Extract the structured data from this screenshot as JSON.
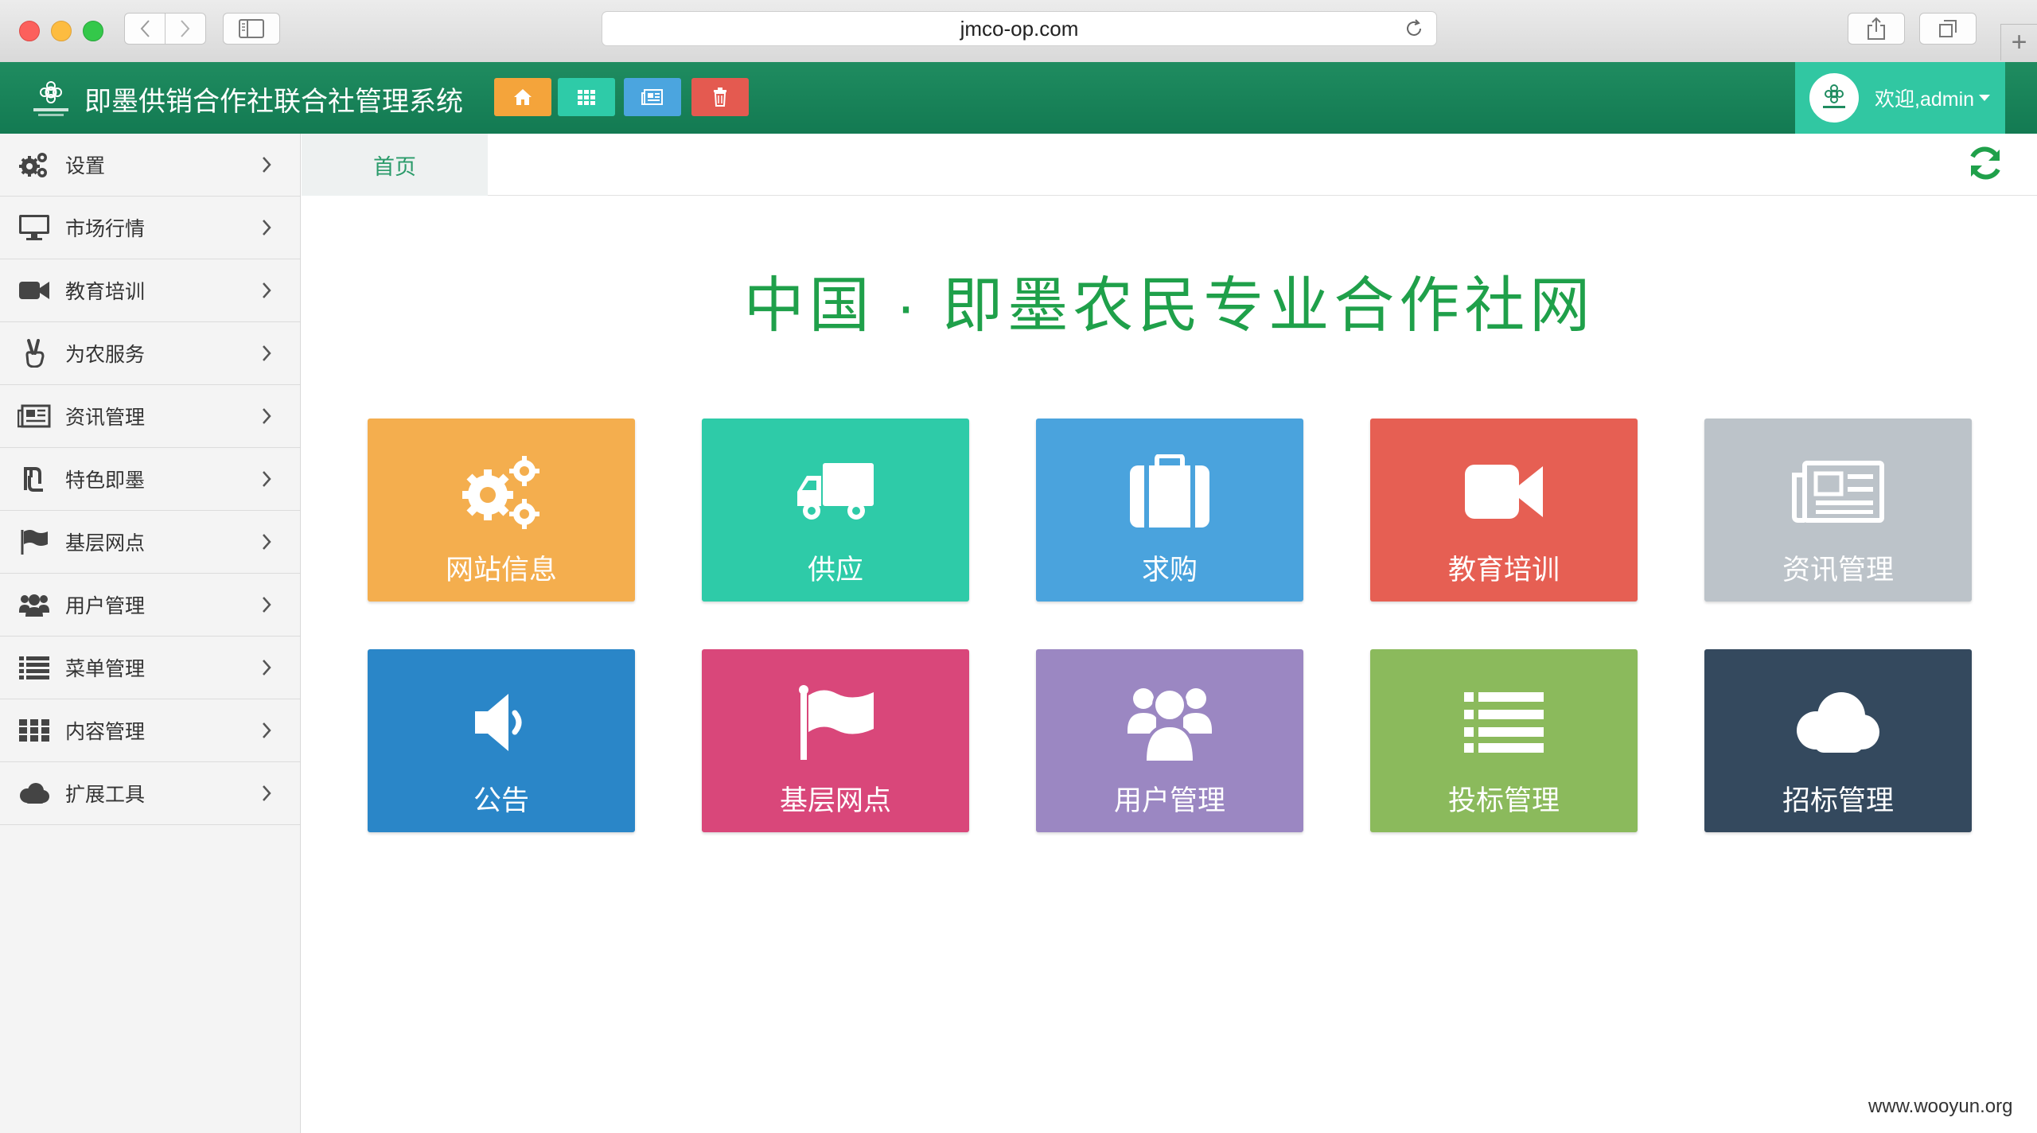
{
  "browser": {
    "url": "jmco-op.com",
    "new_tab_symbol": "+"
  },
  "header": {
    "title": "即墨供销合作社联合社管理系统",
    "user_greeting": "欢迎,admin"
  },
  "sidebar": {
    "items": [
      {
        "label": "设置",
        "icon": "gears-icon"
      },
      {
        "label": "市场行情",
        "icon": "desktop-icon"
      },
      {
        "label": "教育培训",
        "icon": "video-camera-icon"
      },
      {
        "label": "为农服务",
        "icon": "victory-hand-icon"
      },
      {
        "label": "资讯管理",
        "icon": "newspaper-icon"
      },
      {
        "label": "特色即墨",
        "icon": "shekel-icon"
      },
      {
        "label": "基层网点",
        "icon": "flag-icon"
      },
      {
        "label": "用户管理",
        "icon": "users-icon"
      },
      {
        "label": "菜单管理",
        "icon": "list-icon"
      },
      {
        "label": "内容管理",
        "icon": "grid-icon"
      },
      {
        "label": "扩展工具",
        "icon": "cloud-icon"
      }
    ]
  },
  "tabs": {
    "home": "首页"
  },
  "main": {
    "title": "中国 · 即墨农民专业合作社网",
    "tiles": [
      {
        "label": "网站信息",
        "icon": "gears-icon",
        "color": "#f4ae4e"
      },
      {
        "label": "供应",
        "icon": "truck-icon",
        "color": "#2ecba8"
      },
      {
        "label": "求购",
        "icon": "briefcase-icon",
        "color": "#4aa3dd"
      },
      {
        "label": "教育培训",
        "icon": "video-camera-icon",
        "color": "#e65f53"
      },
      {
        "label": "资讯管理",
        "icon": "newspaper-icon",
        "color": "#bcc3c9"
      },
      {
        "label": "公告",
        "icon": "volume-icon",
        "color": "#2a86c8"
      },
      {
        "label": "基层网点",
        "icon": "flag-icon",
        "color": "#d9477a"
      },
      {
        "label": "用户管理",
        "icon": "users-icon",
        "color": "#9b87c2"
      },
      {
        "label": "投标管理",
        "icon": "list-icon",
        "color": "#8bba5c"
      },
      {
        "label": "招标管理",
        "icon": "cloud-icon",
        "color": "#34495e"
      }
    ]
  },
  "watermark": "www.wooyun.org",
  "colors": {
    "header": "#188558",
    "accent": "#31c7a2",
    "title_green": "#1fa04a"
  }
}
